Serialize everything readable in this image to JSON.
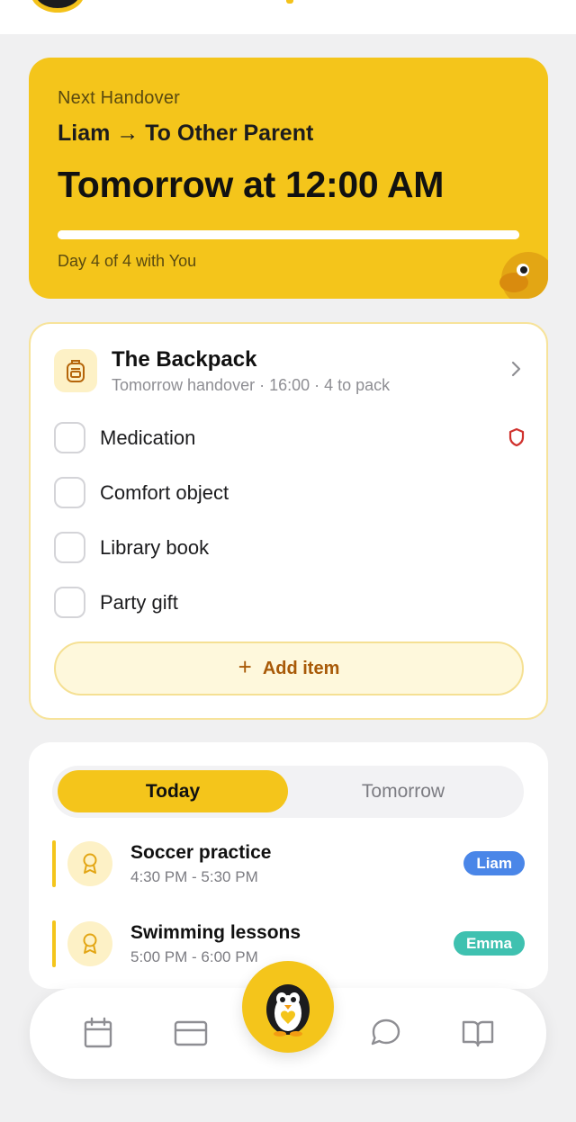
{
  "theme": {
    "accent": "#f4c51b",
    "accent_dark": "#a85a08",
    "danger": "#d0312d",
    "tag_liam": "#4a86e8",
    "tag_emma": "#3fc1b0"
  },
  "handover": {
    "label": "Next Handover",
    "who": "Liam → To Other Parent",
    "when": "Tomorrow at 12:00 AM",
    "progress_fraction": 1.0,
    "days": "Day 4 of 4 with You",
    "mascot_icon": "toucan-mascot-icon"
  },
  "backpack": {
    "icon": "backpack-icon",
    "title": "The Backpack",
    "subtitle": "Tomorrow handover · 16:00 · 4 to pack",
    "items": [
      {
        "label": "Medication",
        "checked": false,
        "badge": "shield-icon"
      },
      {
        "label": "Comfort object",
        "checked": false
      },
      {
        "label": "Library book",
        "checked": false
      },
      {
        "label": "Party gift",
        "checked": false
      }
    ],
    "add_label": "Add item",
    "add_icon": "+"
  },
  "schedule": {
    "tabs": [
      {
        "label": "Today",
        "active": true
      },
      {
        "label": "Tomorrow",
        "active": false
      }
    ],
    "events": [
      {
        "title": "Soccer practice",
        "time": "4:30 PM - 5:30 PM",
        "child": "Liam",
        "icon": "award-icon"
      },
      {
        "title": "Swimming lessons",
        "time": "5:00 PM - 6:00 PM",
        "child": "Emma",
        "icon": "award-icon"
      }
    ]
  },
  "nav": {
    "items": [
      "calendar-icon",
      "card-icon",
      "penguin-fab-icon",
      "chat-icon",
      "book-icon"
    ]
  }
}
